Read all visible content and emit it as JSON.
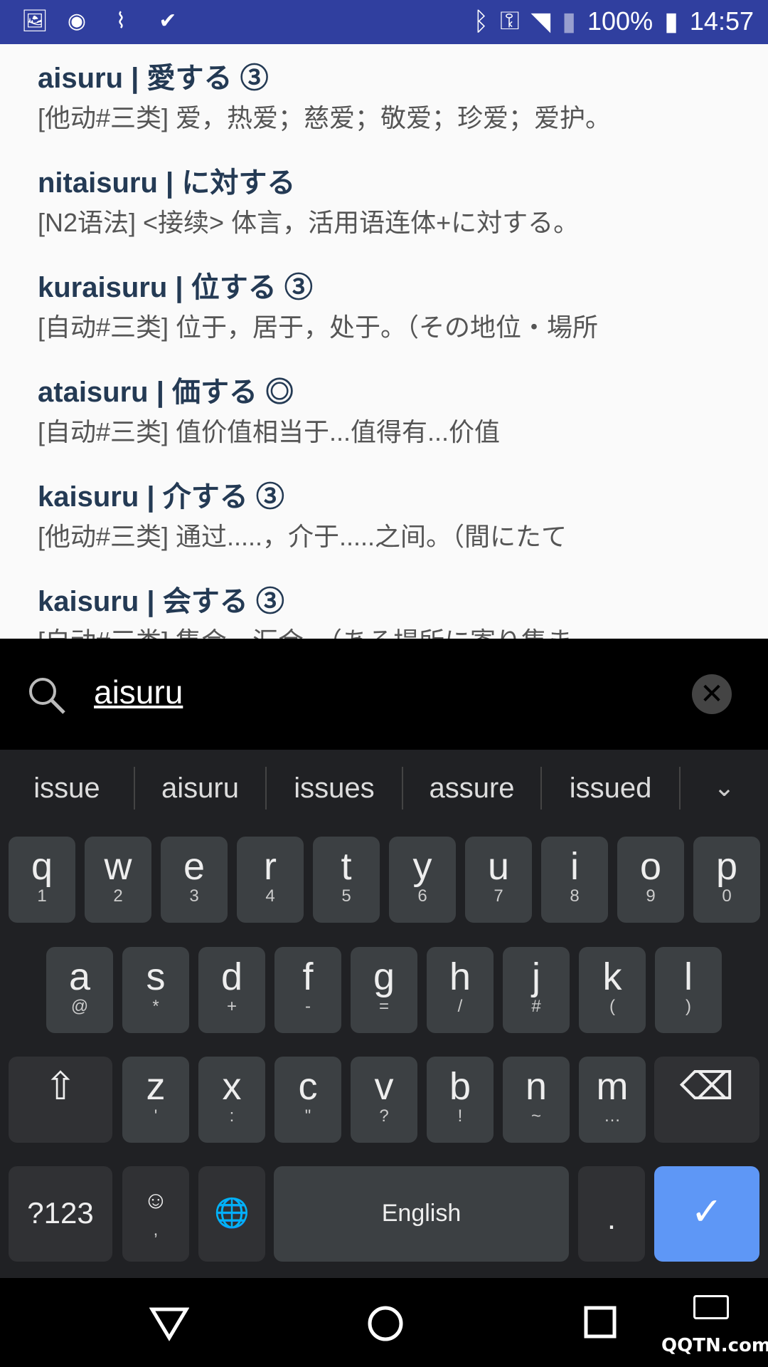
{
  "status_bar": {
    "battery": "100%",
    "time": "14:57",
    "left_icons": [
      "image-icon",
      "circle-icon",
      "activity-icon",
      "check-icon"
    ],
    "right_icons": [
      "bluetooth-icon",
      "key-icon",
      "wifi-off-icon",
      "no-sim-icon",
      "battery-charging-icon"
    ]
  },
  "entries": [
    {
      "title": "aisuru | 愛する ③",
      "desc": "[他动#三类] 爱，热爱；慈爱；敬爱；珍爱；爱护。"
    },
    {
      "title": "nitaisuru | に対する",
      "desc": "[N2语法] <接续> 体言，活用语连体+に対する。"
    },
    {
      "title": "kuraisuru | 位する ③",
      "desc": "[自动#三类] 位于，居于，处于。（その地位・場所"
    },
    {
      "title": "ataisuru | 価する ◎",
      "desc": "[自动#三类] 值价值相当于...值得有...价值"
    },
    {
      "title": "kaisuru | 介する ③",
      "desc": "[他动#三类] 通过.....，介于.....之间。（間にたて"
    },
    {
      "title": "kaisuru | 会する ③",
      "desc": "[自动#三类] 集会，汇合。（ある場所に寄り集ま"
    }
  ],
  "search": {
    "query": "aisuru"
  },
  "suggestions": [
    "issue",
    "aisuru",
    "issues",
    "assure",
    "issued"
  ],
  "keyboard": {
    "row1": [
      [
        "q",
        "1"
      ],
      [
        "w",
        "2"
      ],
      [
        "e",
        "3"
      ],
      [
        "r",
        "4"
      ],
      [
        "t",
        "5"
      ],
      [
        "y",
        "6"
      ],
      [
        "u",
        "7"
      ],
      [
        "i",
        "8"
      ],
      [
        "o",
        "9"
      ],
      [
        "p",
        "0"
      ]
    ],
    "row2": [
      [
        "a",
        "@"
      ],
      [
        "s",
        "*"
      ],
      [
        "d",
        "+"
      ],
      [
        "f",
        "-"
      ],
      [
        "g",
        "="
      ],
      [
        "h",
        "/"
      ],
      [
        "j",
        "#"
      ],
      [
        "k",
        "("
      ],
      [
        "l",
        ")"
      ]
    ],
    "row3": [
      [
        "z",
        "'"
      ],
      [
        "x",
        ":"
      ],
      [
        "c",
        "\""
      ],
      [
        "v",
        "?"
      ],
      [
        "b",
        "!"
      ],
      [
        "n",
        "~"
      ],
      [
        "m",
        "…"
      ]
    ],
    "symbols_label": "?123",
    "emoji_sub": ",",
    "space_label": "English",
    "period": ".",
    "accent": "#5e97f6"
  },
  "watermark": "QQTN.com"
}
